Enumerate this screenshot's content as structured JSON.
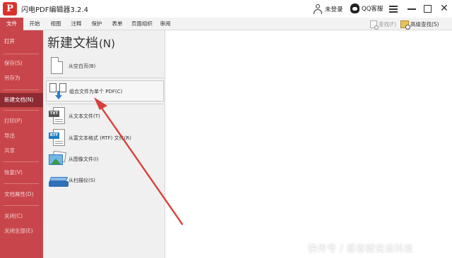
{
  "app": {
    "logo_letter": "P",
    "title": "闪电PDF编辑器3.2.4",
    "user_label": "未登录",
    "qq_label": "QQ客服",
    "close_glyph": "✕"
  },
  "menubar": {
    "items": [
      "文件",
      "开始",
      "视图",
      "注释",
      "保护",
      "表单",
      "页面组织",
      "审阅"
    ],
    "active_index": 0,
    "find_label": "查找(F)",
    "adv_find_label": "高级查找(S)"
  },
  "sidebar": {
    "items": [
      {
        "label": "打开"
      },
      {
        "label": "保存(S)"
      },
      {
        "label": "另存为"
      },
      {
        "label": "新建文档(N)"
      },
      {
        "label": "打印(P)"
      },
      {
        "label": "导出"
      },
      {
        "label": "共享"
      },
      {
        "label": "恢复(V)"
      },
      {
        "label": "文档属性(D)"
      },
      {
        "label": "关闭(C)"
      },
      {
        "label": "关闭全部(E)"
      }
    ],
    "selected_index": 3
  },
  "panel": {
    "title": "新建文档",
    "title_shortcut": "(N)",
    "options": [
      {
        "label": "从空白页(B)",
        "icon": "blank-page-icon"
      },
      {
        "label": "组合文件为单个 PDF(C)",
        "icon": "combine-files-icon"
      },
      {
        "label": "从文本文件(T)",
        "icon": "txt-file-icon",
        "badge": "TXT"
      },
      {
        "label": "从富文本格式 (RTF) 文件(R)",
        "icon": "rtf-file-icon",
        "badge": "RTF"
      },
      {
        "label": "从图像文件(I)",
        "icon": "image-file-icon"
      },
      {
        "label": "从扫描仪(S)",
        "icon": "scanner-icon"
      }
    ],
    "highlighted_index": 1
  },
  "watermark": "快传号 / 暴容胆说谈科技",
  "colors": {
    "accent": "#c8464b",
    "sidebar_selected": "#8e2a31",
    "annotation_arrow": "#d9403a",
    "panel_bg": "#f0f0f0"
  }
}
